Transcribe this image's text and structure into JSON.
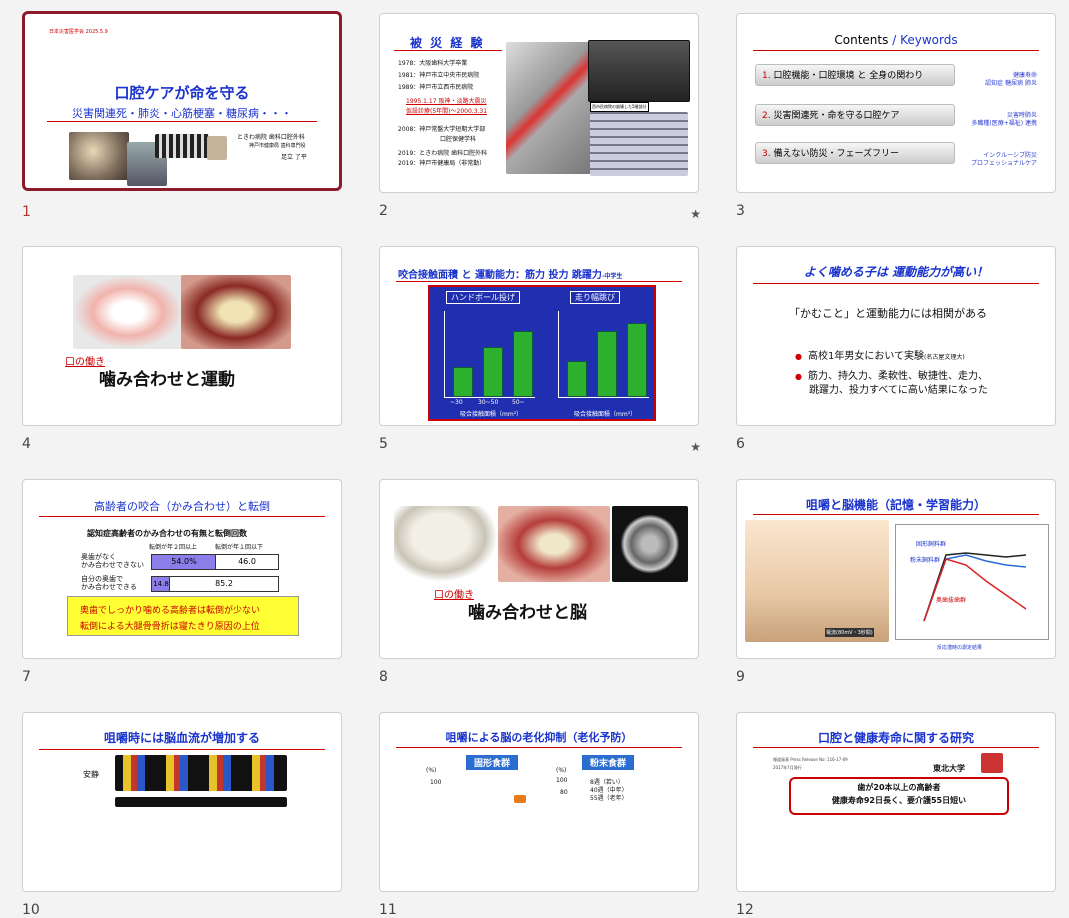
{
  "slides": [
    {
      "number": "1",
      "lines": [
        "口腔ケアが命を守る",
        "災害関連死・肺炎・心筋梗塞・糖尿病・・・",
        "ときわ病院 歯科口腔外科",
        "神戸市健康局 歯科専門役",
        "足立 了平",
        "日本災害医学会 2025.5.9"
      ]
    },
    {
      "number": "2",
      "title": "被 災 経 験",
      "lines": [
        "1978：大阪歯科大学卒業",
        "1981：神戸市立中央市民病院",
        "1989：神戸市立西市民病院",
        "1995.1.17 阪神・淡路大震災",
        "仮設診療(5年間)～2000.3.31",
        "2008：神戸常盤大学短期大学部",
        "口腔保健学科",
        "2019：ときわ病院 歯科口腔外科",
        "2019：神戸市健康局（非常勤）",
        "西市民病院の崩壊した5階部分"
      ]
    },
    {
      "number": "3",
      "title": "Contents",
      "title_accent": "Keywords",
      "items": [
        {
          "n": "1.",
          "label": "口腔機能・口腔環境 と 全身の関わり",
          "kw": [
            "健康寿命",
            "認知症 糖尿病 肺炎"
          ]
        },
        {
          "n": "2.",
          "label": "災害関連死・命を守る口腔ケア",
          "kw": [
            "災害時肺炎",
            "多職種(医療+福祉) 連携"
          ]
        },
        {
          "n": "3.",
          "label": "備えない防災・フェーズフリー",
          "kw": [
            "インクルーシブ防災",
            "プロフェッショナルケア"
          ]
        }
      ]
    },
    {
      "number": "4",
      "lines": [
        "口の働き",
        "噛み合わせと運動"
      ]
    },
    {
      "number": "5",
      "title": "咬合接触面積 と 運動能力：筋力 投力 跳躍力",
      "title_small": "-中学生",
      "chart_labels": [
        "ハンドボール投げ",
        "走り幅跳び",
        "吸合接触面積（mm²）",
        "~30",
        "30~50",
        "50~"
      ]
    },
    {
      "number": "6",
      "title": "よく噛める子は 運動能力が高い！",
      "lines": [
        "「かむこと」と運動能力には相関がある",
        "高校1年男女において実験",
        "(名古屋文理大)",
        "筋力、持久力、柔軟性、敏捷性、走力、",
        "跳躍力、投力すべてに高い結果になった"
      ]
    },
    {
      "number": "7",
      "title": "高齢者の咬合（かみ合わせ）と転倒",
      "lines": [
        "認知症高齢者のかみ合わせの有無と転倒回数",
        "転倒が年２回以上",
        "転倒が年１回以下",
        "奥歯がなく",
        "かみ合わせできない",
        "自分の奥歯で",
        "かみ合わせできる",
        "54.0%",
        "46.0",
        "14.8",
        "85.2",
        "奥歯でしっかり噛める高齢者は転倒が少ない",
        "転倒による大腿骨骨折は寝たきり原因の上位"
      ]
    },
    {
      "number": "8",
      "lines": [
        "口の働き",
        "噛み合わせと脳"
      ]
    },
    {
      "number": "9",
      "title": "咀嚼と脳機能（記憶・学習能力）",
      "lines": [
        "固形飼料群",
        "粉末飼料群",
        "奥歯抜歯群",
        "電流(80mV・3秒間)",
        "反応潜時の測定結果"
      ]
    },
    {
      "number": "10",
      "title": "咀嚼時には脳血流が増加する",
      "lines": [
        "安静"
      ]
    },
    {
      "number": "11",
      "title": "咀嚼による脳の老化抑制（老化予防）",
      "lines": [
        "固形食群",
        "粉末食群",
        "(%)",
        "100",
        "80",
        "60",
        "8週（若い）",
        "40週（中年）",
        "55週（老年）"
      ]
    },
    {
      "number": "12",
      "title": "口腔と健康寿命に関する研究",
      "lines": [
        "東北大学",
        "報道発表 Press Release No: 116-17-09",
        "2017年7月発行",
        "歯が20本以上の高齢者",
        "健康寿命92日長く、要介護55日短い"
      ]
    }
  ],
  "colors": {
    "selection": "#8b1a2b",
    "accent_red": "#cc0000",
    "accent_blue": "#1a33cc",
    "bar_green": "#2db02d"
  }
}
